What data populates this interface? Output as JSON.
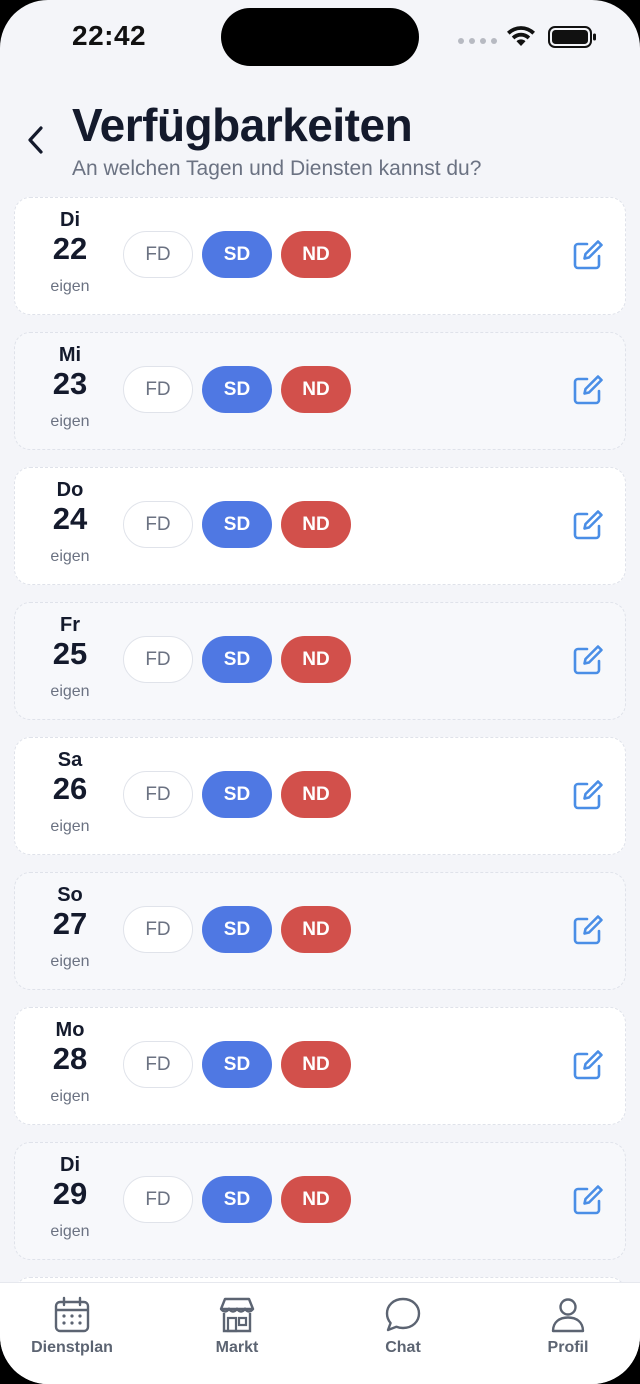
{
  "status_bar": {
    "time": "22:42"
  },
  "header": {
    "title": "Verfügbarkeiten",
    "subtitle": "An welchen Tagen und Diensten kannst du?"
  },
  "days": [
    {
      "weekday": "Di",
      "day": "22",
      "source": "eigen",
      "shifts": {
        "fd": "FD",
        "sd": "SD",
        "nd": "ND"
      }
    },
    {
      "weekday": "Mi",
      "day": "23",
      "source": "eigen",
      "shifts": {
        "fd": "FD",
        "sd": "SD",
        "nd": "ND"
      }
    },
    {
      "weekday": "Do",
      "day": "24",
      "source": "eigen",
      "shifts": {
        "fd": "FD",
        "sd": "SD",
        "nd": "ND"
      }
    },
    {
      "weekday": "Fr",
      "day": "25",
      "source": "eigen",
      "shifts": {
        "fd": "FD",
        "sd": "SD",
        "nd": "ND"
      }
    },
    {
      "weekday": "Sa",
      "day": "26",
      "source": "eigen",
      "shifts": {
        "fd": "FD",
        "sd": "SD",
        "nd": "ND"
      }
    },
    {
      "weekday": "So",
      "day": "27",
      "source": "eigen",
      "shifts": {
        "fd": "FD",
        "sd": "SD",
        "nd": "ND"
      }
    },
    {
      "weekday": "Mo",
      "day": "28",
      "source": "eigen",
      "shifts": {
        "fd": "FD",
        "sd": "SD",
        "nd": "ND"
      }
    },
    {
      "weekday": "Di",
      "day": "29",
      "source": "eigen",
      "shifts": {
        "fd": "FD",
        "sd": "SD",
        "nd": "ND"
      }
    }
  ],
  "tabs": [
    {
      "label": "Dienstplan",
      "icon": "calendar-icon"
    },
    {
      "label": "Markt",
      "icon": "store-icon"
    },
    {
      "label": "Chat",
      "icon": "chat-bubble-icon"
    },
    {
      "label": "Profil",
      "icon": "person-icon"
    }
  ],
  "colors": {
    "accent": "#4f78e3",
    "night_shift": "#d2504b",
    "edit_icon": "#4a8ee6",
    "background": "#f4f5f9"
  }
}
